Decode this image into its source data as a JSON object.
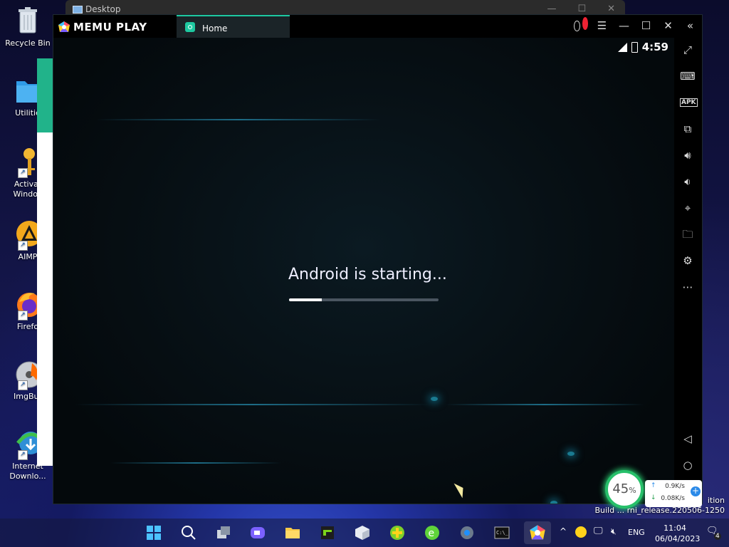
{
  "desktop": {
    "icons": [
      {
        "label": "Recycle Bin"
      },
      {
        "label": "Utilitie"
      },
      {
        "label": "Activat\nWindov"
      },
      {
        "label": "AIMP"
      },
      {
        "label": "Firefo"
      },
      {
        "label": "ImgBur"
      },
      {
        "label": "Internet\nDownlo..."
      }
    ],
    "background_window_title": "Desktop"
  },
  "memu": {
    "logo_text": "MEMU PLAY",
    "tab_label": "Home",
    "status_time": "4:59",
    "boot_message": "Android is starting...",
    "boot_progress": 0.22,
    "accent_color": "#1ec8a0",
    "toolbar": [
      "fullscreen-icon",
      "keyboard-icon",
      "apk-icon",
      "multi-instance-icon",
      "volume-up-icon",
      "volume-down-icon",
      "location-icon",
      "folder-icon",
      "settings-icon",
      "more-icon",
      "back-icon",
      "home-icon",
      "recents-icon"
    ],
    "apk_label": "APK"
  },
  "net_widget": {
    "percent": "45",
    "percent_unit": "%",
    "upload": "0.9K/s",
    "download": "0.08K/s"
  },
  "watermark": {
    "line1": "ition",
    "line2": "Build ... rni_release.220506-1250"
  },
  "taskbar": {
    "language": "ENG",
    "time": "11:04",
    "date": "06/04/2023",
    "notification_count": "4"
  }
}
